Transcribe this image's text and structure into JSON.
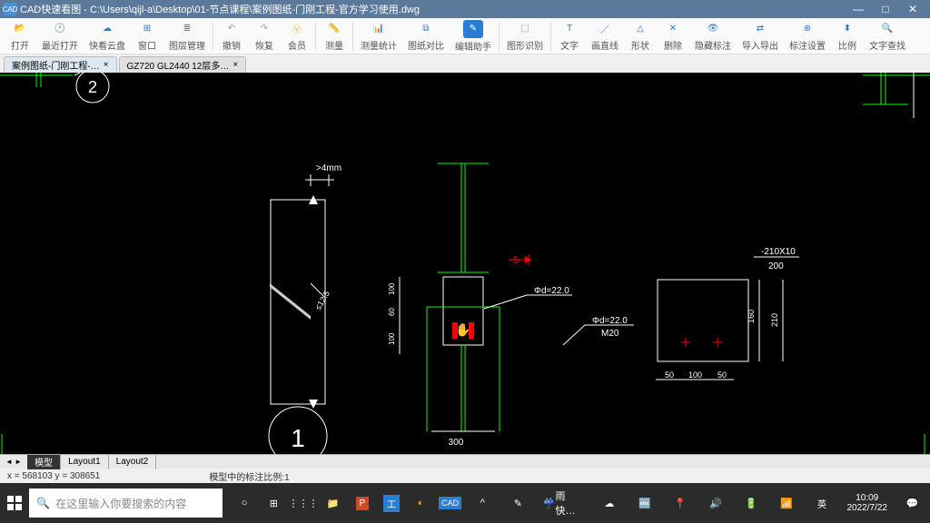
{
  "titlebar": {
    "app_icon": "CAD",
    "title": "CAD快速看图 - C:\\Users\\qijl-a\\Desktop\\01-节点课程\\案例图纸-门刚工程-官方学习使用.dwg"
  },
  "toolbar": [
    {
      "label": "打开",
      "icon": "folder-open",
      "color": "#2b7cd3"
    },
    {
      "label": "最近打开",
      "icon": "clock",
      "color": "#2b7cd3"
    },
    {
      "label": "快看云盘",
      "icon": "cloud",
      "color": "#2b7cd3"
    },
    {
      "label": "窗口",
      "icon": "window",
      "color": "#2b7cd3"
    },
    {
      "label": "图层管理",
      "icon": "layers",
      "color": "#2b7cd3"
    },
    {
      "label": "撤销",
      "icon": "undo",
      "color": "#999"
    },
    {
      "label": "恢复",
      "icon": "redo",
      "color": "#999"
    },
    {
      "label": "会员",
      "icon": "vip",
      "color": "#f5a623"
    },
    {
      "label": "测量",
      "icon": "ruler",
      "color": "#2b7cd3"
    },
    {
      "label": "测量统计",
      "icon": "stats",
      "color": "#2b7cd3"
    },
    {
      "label": "图纸对比",
      "icon": "compare",
      "color": "#2b7cd3"
    },
    {
      "label": "编辑助手",
      "icon": "edit-assist",
      "color": "#2b7cd3",
      "bg": true
    },
    {
      "label": "图形识别",
      "icon": "recognize",
      "color": "#2b7cd3"
    },
    {
      "label": "文字",
      "icon": "text",
      "color": "#2b7cd3"
    },
    {
      "label": "画直线",
      "icon": "line",
      "color": "#2b7cd3"
    },
    {
      "label": "形状",
      "icon": "shape",
      "color": "#2b7cd3"
    },
    {
      "label": "删除",
      "icon": "delete",
      "color": "#2b7cd3"
    },
    {
      "label": "隐藏标注",
      "icon": "hide",
      "color": "#2b7cd3"
    },
    {
      "label": "导入导出",
      "icon": "import",
      "color": "#2b7cd3"
    },
    {
      "label": "标注设置",
      "icon": "annotation",
      "color": "#2b7cd3"
    },
    {
      "label": "比例",
      "icon": "scale",
      "color": "#2b7cd3"
    },
    {
      "label": "文字查找",
      "icon": "search-text",
      "color": "#2b7cd3"
    }
  ],
  "tabs": [
    {
      "label": "案例图纸-门刚工程-…",
      "active": true
    },
    {
      "label": "GZ720 GL2440 12层多… ",
      "active": false
    }
  ],
  "drawing": {
    "dim1": ">4mm",
    "dim2": "≤12.5",
    "circle1": "2",
    "circle2": "1",
    "bolt1": "Φd=22.0",
    "bolt2": "Φd=22.0",
    "bolt3": "M20",
    "dim300": "300",
    "dim5": "5",
    "plate": "-210X10",
    "dim200": "200",
    "dim160": "160",
    "dim210": "210",
    "dim50a": "50",
    "dim100": "100",
    "dim50b": "50",
    "dim100h": "100",
    "dim60": "60",
    "dim100h2": "100"
  },
  "layout_tabs": [
    "模型",
    "Layout1",
    "Layout2"
  ],
  "statusbar": {
    "coords": "x = 568103 y = 308651",
    "scale": "模型中的标注比例:1"
  },
  "taskbar": {
    "search_placeholder": "在这里输入你要搜索的内容",
    "weather": "雨快…",
    "time": "10:09",
    "date": "2022/7/22"
  }
}
